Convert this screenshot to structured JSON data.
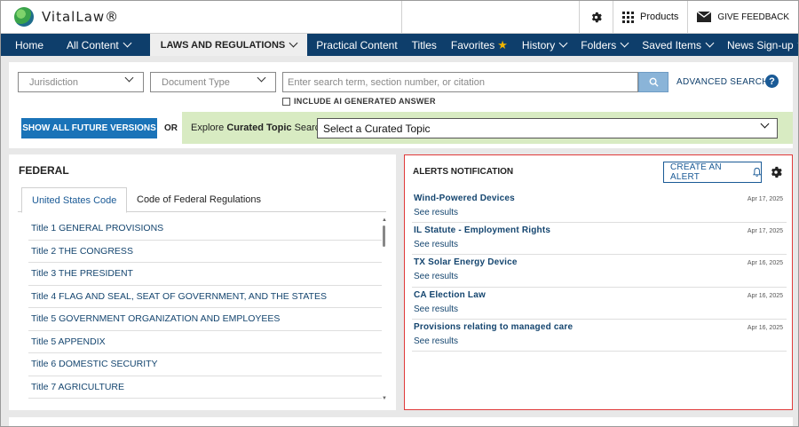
{
  "header": {
    "logo_text": "VitalLaw®",
    "products_label": "Products",
    "feedback_label": "GIVE FEEDBACK"
  },
  "nav": {
    "home": "Home",
    "all_content": "All Content",
    "laws": "LAWS AND REGULATIONS",
    "practical": "Practical Content",
    "titles": "Titles",
    "favorites": "Favorites",
    "history": "History",
    "folders": "Folders",
    "saved": "Saved Items",
    "news": "News Sign-up"
  },
  "search": {
    "jurisdiction_placeholder": "Jurisdiction",
    "doctype_placeholder": "Document Type",
    "input_placeholder": "Enter search term, section number, or citation",
    "advanced_label": "ADVANCED SEARCH",
    "help_label": "?",
    "ai_label": "INCLUDE AI GENERATED ANSWER",
    "show_future_label": "SHOW ALL FUTURE VERSIONS",
    "or_label": "OR",
    "curated_prefix": "Explore",
    "curated_bold": "Curated Topic",
    "curated_suffix": "Search",
    "curated_select": "Select a Curated Topic"
  },
  "federal": {
    "title": "FEDERAL",
    "tabs": [
      "United States Code",
      "Code of Federal Regulations"
    ],
    "items": [
      "Title 1 GENERAL PROVISIONS",
      "Title 2 THE CONGRESS",
      "Title 3 THE PRESIDENT",
      "Title 4 FLAG AND SEAL, SEAT OF GOVERNMENT, AND THE STATES",
      "Title 5 GOVERNMENT ORGANIZATION AND EMPLOYEES",
      "Title 5 APPENDIX",
      "Title 6 DOMESTIC SECURITY",
      "Title 7 AGRICULTURE"
    ]
  },
  "alerts": {
    "title": "ALERTS NOTIFICATION",
    "create_label": "CREATE AN ALERT",
    "see_label": "See results",
    "items": [
      {
        "name": "Wind-Powered Devices",
        "date": "Apr 17, 2025"
      },
      {
        "name": "IL Statute - Employment Rights",
        "date": "Apr 17, 2025"
      },
      {
        "name": "TX Solar Energy Device",
        "date": "Apr 16, 2025"
      },
      {
        "name": "CA Election Law",
        "date": "Apr 16, 2025"
      },
      {
        "name": "Provisions relating to managed care",
        "date": "Apr 16, 2025"
      }
    ]
  },
  "colors": {
    "nav_bg": "#0e3e6b",
    "accent_blue": "#1a73b8",
    "curated_bg": "#d8ebc2",
    "alert_border": "#e03a3a",
    "star": "#f0b400"
  },
  "icons": [
    "globe-logo-icon",
    "gear-icon",
    "grid-icon",
    "envelope-icon",
    "chevron-down-icon",
    "star-icon",
    "search-icon",
    "help-icon",
    "bell-icon"
  ]
}
